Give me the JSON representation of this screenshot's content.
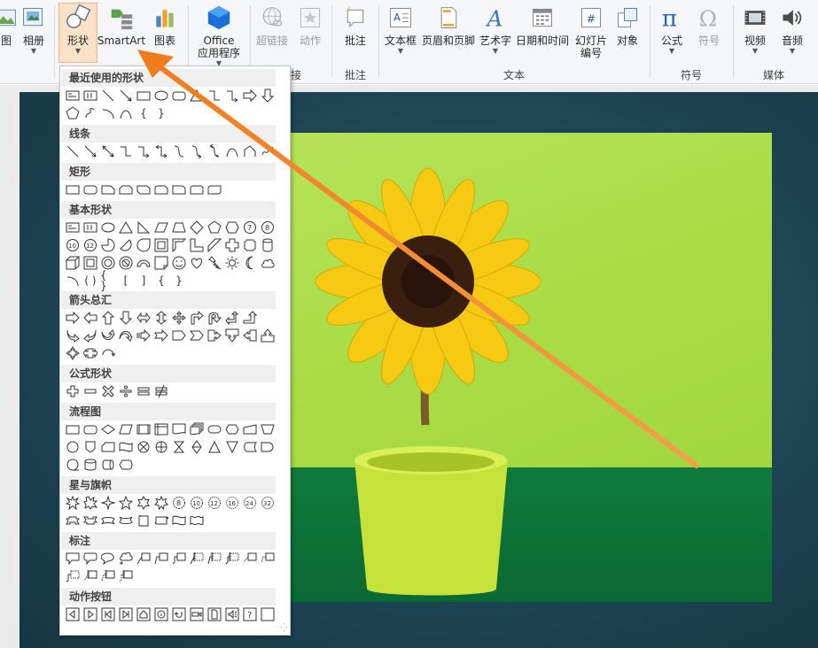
{
  "ribbon": {
    "buttons": [
      {
        "key": "picture",
        "label": "图",
        "has_caret": false,
        "disabled": false
      },
      {
        "key": "album",
        "label": "相册",
        "has_caret": true,
        "disabled": false
      },
      {
        "key": "shapes",
        "label": "形状",
        "has_caret": true,
        "disabled": false,
        "active": true
      },
      {
        "key": "smartart",
        "label": "SmartArt",
        "has_caret": false,
        "disabled": false
      },
      {
        "key": "chart",
        "label": "图表",
        "has_caret": false,
        "disabled": false
      },
      {
        "key": "office_apps",
        "label": "Office\n应用程序",
        "has_caret": true,
        "disabled": false
      },
      {
        "key": "hyperlink",
        "label": "超链接",
        "has_caret": false,
        "disabled": true
      },
      {
        "key": "action",
        "label": "动作",
        "has_caret": false,
        "disabled": true
      },
      {
        "key": "comment",
        "label": "批注",
        "has_caret": false,
        "disabled": false
      },
      {
        "key": "textbox",
        "label": "文本框",
        "has_caret": true,
        "disabled": false
      },
      {
        "key": "header_footer",
        "label": "页眉和页脚",
        "has_caret": false,
        "disabled": false
      },
      {
        "key": "wordart",
        "label": "艺术字",
        "has_caret": true,
        "disabled": false
      },
      {
        "key": "datetime",
        "label": "日期和时间",
        "has_caret": false,
        "disabled": false
      },
      {
        "key": "slide_number",
        "label": "幻灯片\n编号",
        "has_caret": false,
        "disabled": false
      },
      {
        "key": "object",
        "label": "对象",
        "has_caret": false,
        "disabled": false
      },
      {
        "key": "equation",
        "label": "公式",
        "has_caret": true,
        "disabled": false
      },
      {
        "key": "symbol",
        "label": "符号",
        "has_caret": false,
        "disabled": true
      },
      {
        "key": "video",
        "label": "视频",
        "has_caret": true,
        "disabled": false
      },
      {
        "key": "audio",
        "label": "音频",
        "has_caret": true,
        "disabled": false
      }
    ],
    "groups": {
      "links_partial": "接",
      "comments": "批注",
      "text": "文本",
      "symbols": "符号",
      "media": "媒体"
    }
  },
  "shapes_menu": {
    "sections": {
      "recent": "最近使用的形状",
      "lines": "线条",
      "rectangles": "矩形",
      "basic": "基本形状",
      "block_arrows": "箭头总汇",
      "equation": "公式形状",
      "flowchart": "流程图",
      "stars": "星与旗帜",
      "callouts": "标注",
      "action_buttons": "动作按钮"
    }
  },
  "colors": {
    "accent_orange": "#f07c1e",
    "active_tab_bg": "#fde1c8"
  }
}
